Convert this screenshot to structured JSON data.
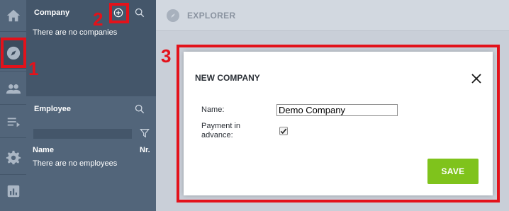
{
  "rail": {
    "items": [
      {
        "icon": "home-icon"
      },
      {
        "icon": "compass-icon",
        "active": true
      },
      {
        "icon": "users-icon"
      },
      {
        "icon": "list-icon"
      },
      {
        "icon": "gear-icon"
      },
      {
        "icon": "chart-icon"
      }
    ]
  },
  "company": {
    "title": "Company",
    "empty_text": "There are no companies"
  },
  "employee": {
    "title": "Employee",
    "col_name": "Name",
    "col_nr": "Nr.",
    "empty_text": "There are no employees"
  },
  "header": {
    "title": "EXPLORER"
  },
  "dialog": {
    "title": "NEW COMPANY",
    "name_label": "Name:",
    "name_value": "Demo Company",
    "payment_label_line1": "Payment in",
    "payment_label_line2": "advance:",
    "payment_checked": true,
    "save_label": "SAVE"
  },
  "annotations": {
    "one": "1",
    "two": "2",
    "three": "3"
  },
  "colors": {
    "annotation": "#e3121b",
    "save": "#7fc31c",
    "panel": "#44566a",
    "rail": "#52657a"
  }
}
